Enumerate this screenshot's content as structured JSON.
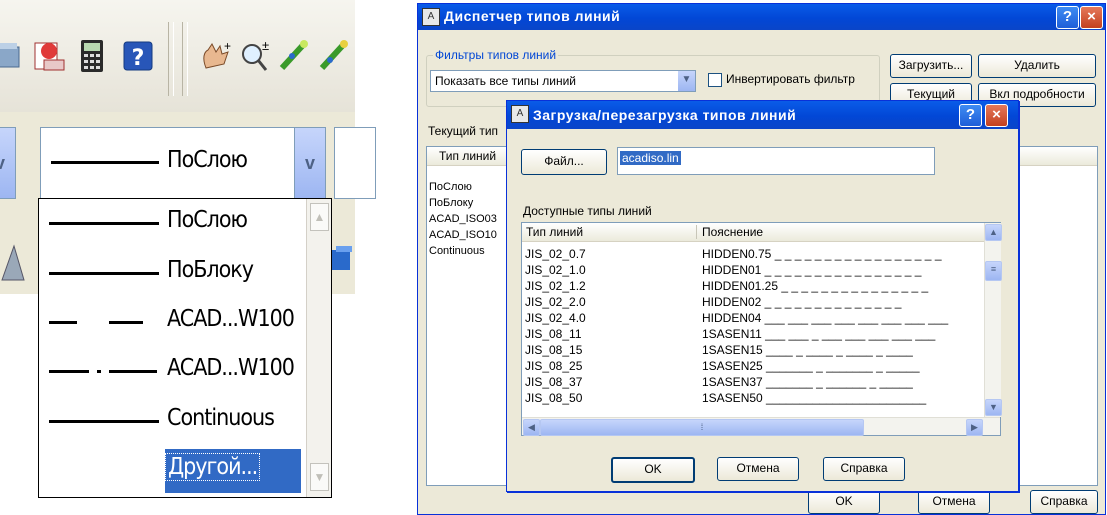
{
  "left_panel": {
    "toolbar_icons": [
      "layer-icon",
      "sheet-set-icon",
      "calculator-icon",
      "help-icon",
      "pan-icon",
      "zoom-realtime-icon",
      "pencil-icon",
      "pencil-2-icon"
    ],
    "combo_value": "ПоСлою",
    "dropdown_items": [
      {
        "label": "ПоСлою",
        "line": "solid"
      },
      {
        "label": "ПоБлоку",
        "line": "solid"
      },
      {
        "label": "ACAD...W100",
        "line": "dashed"
      },
      {
        "label": "ACAD...W100",
        "line": "dashdot"
      },
      {
        "label": "Continuous",
        "line": "solid"
      },
      {
        "label": "Другой...",
        "line": "none",
        "selected": true
      }
    ]
  },
  "manager": {
    "title": "Диспетчер типов линий",
    "filter_group_label": "Фильтры типов линий",
    "filter_value": "Показать все типы линий",
    "invert_label": "Инвертировать фильтр",
    "buttons": {
      "load": "Загрузить...",
      "delete": "Удалить",
      "current": "Текущий",
      "details": "Вкл подробности",
      "ok": "OK",
      "cancel": "Отмена",
      "help": "Справка"
    },
    "current_label": "Текущий тип",
    "list_header": "Тип линий",
    "list_rows": [
      "ПоСлою",
      "ПоБлоку",
      "ACAD_ISO03",
      "ACAD_ISO10",
      "Continuous"
    ]
  },
  "dialog": {
    "title": "Загрузка/перезагрузка типов линий",
    "file_button": "Файл...",
    "file_value": "acadiso.lin",
    "available_label": "Доступные типы линий",
    "col_type": "Тип линий",
    "col_desc": "Пояснение",
    "rows": [
      {
        "name": "JIS_02_0.7",
        "desc": "HIDDEN0.75 _ _ _ _ _ _ _ _ _ _ _ _ _ _ _ _ _"
      },
      {
        "name": "JIS_02_1.0",
        "desc": "HIDDEN01 _ _ _ _ _ _ _ _ _ _ _ _ _ _ _ _"
      },
      {
        "name": "JIS_02_1.2",
        "desc": "HIDDEN01.25 _ _ _ _ _ _ _ _ _ _ _ _ _ _ _"
      },
      {
        "name": "JIS_02_2.0",
        "desc": "HIDDEN02 _ _ _ _ _ _ _ _ _ _ _ _ _ _"
      },
      {
        "name": "JIS_02_4.0",
        "desc": "HIDDEN04 ___ ___ ___ ___ ___ ___ ___ ___"
      },
      {
        "name": "JIS_08_11",
        "desc": "1SASEN11 ___ ___ _ ___ ___ ___ ___ ___"
      },
      {
        "name": "JIS_08_15",
        "desc": "1SASEN15 ____ _ ____ _ ____ _ ____"
      },
      {
        "name": "JIS_08_25",
        "desc": "1SASEN25 _______ _ _______ _ _____"
      },
      {
        "name": "JIS_08_37",
        "desc": "1SASEN37 _______ _ ______ _ _____"
      },
      {
        "name": "JIS_08_50",
        "desc": "1SASEN50 ________________________"
      }
    ],
    "buttons": {
      "ok": "OK",
      "cancel": "Отмена",
      "help": "Справка"
    }
  }
}
